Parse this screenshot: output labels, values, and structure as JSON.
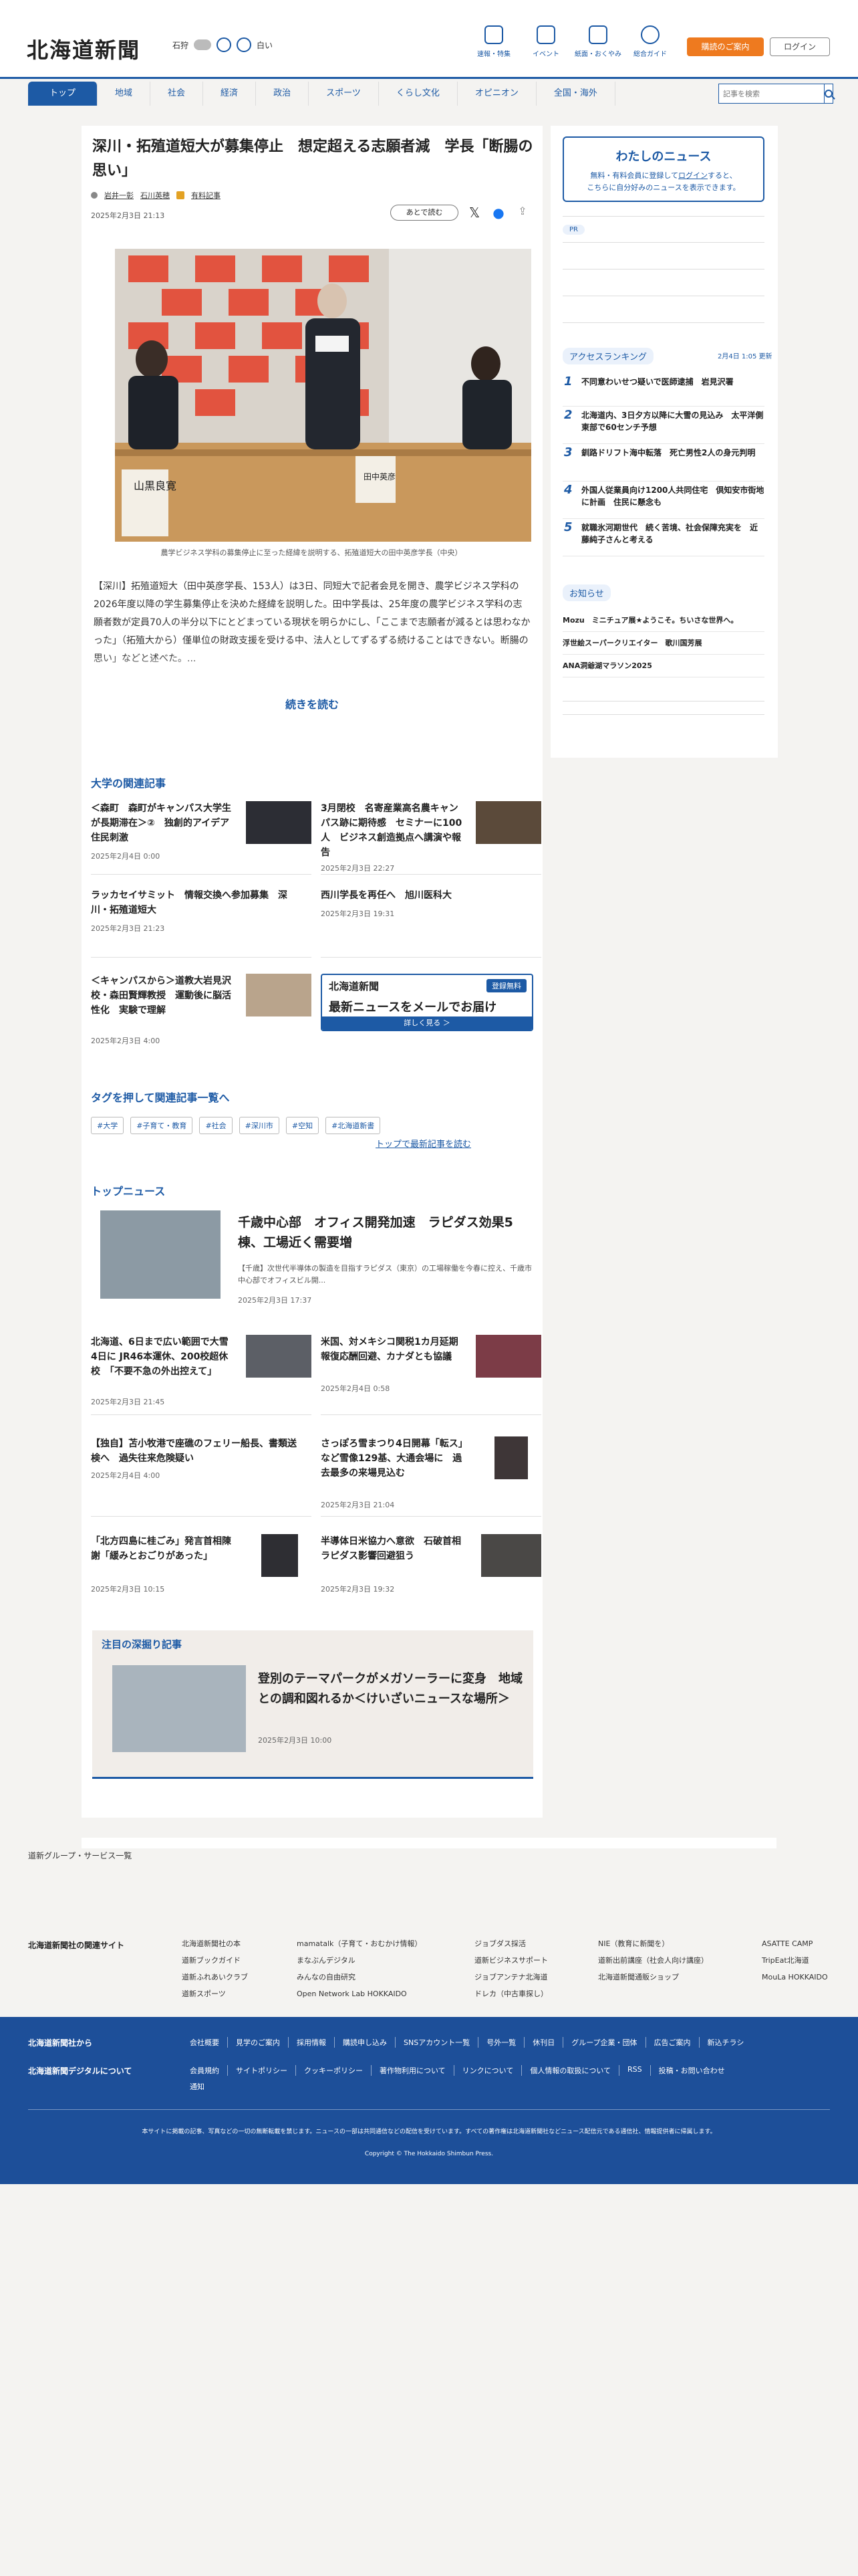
{
  "header": {
    "logo": "北海道新聞",
    "region": "石狩",
    "weather_rain": "白い",
    "icons": [
      {
        "label": "速報・特集",
        "icon": "flag-icon"
      },
      {
        "label": "イベント",
        "icon": "calendar-icon"
      },
      {
        "label": "紙面・おくやみ",
        "icon": "newspaper-icon"
      },
      {
        "label": "総合ガイド",
        "icon": "help-icon"
      }
    ],
    "subscribe_label": "購読のご案内",
    "login_label": "ログイン"
  },
  "nav": {
    "items": [
      "トップ",
      "地域",
      "社会",
      "経済",
      "政治",
      "スポーツ",
      "くらし文化",
      "オピニオン",
      "全国・海外"
    ],
    "search_placeholder": "記事を検索"
  },
  "article": {
    "title": "深川・拓殖道短大が募集停止　想定超える志願者減　学長「断腸の思い」",
    "authors": [
      "岩井一彰",
      "石川英穂"
    ],
    "paid_label": "有料記事",
    "date": "2025年2月3日 21:13",
    "later_label": "あとで読む",
    "caption": "農学ビジネス学科の募集停止に至った経緯を説明する、拓殖道短大の田中英彦学長（中央）",
    "lead": "【深川】拓殖道短大（田中英彦学長、153人）は3日、同短大で記者会見を開き、農学ビジネス学科の2026年度以降の学生募集停止を決めた経緯を説明した。田中学長は、25年度の農学ビジネス学科の志願者数が定員70人の半分以下にとどまっている現状を明らかにし、「ここまで志願者が減るとは思わなかった」（拓殖大から）僅単位の財政支援を受ける中、法人としてずるずる続けることはできない。断腸の思い」などと述べた。...",
    "read_more": "続きを読む",
    "photo_sign": "山黒良寛",
    "photo_sign2": "田中英彦"
  },
  "related": {
    "heading": "大学の関連記事",
    "items": [
      {
        "title": "＜森町　森町がキャンパス大学生が長期滞在＞②　独創的アイデア　住民刺激",
        "date": "2025年2月4日 0:00"
      },
      {
        "title": "3月閉校　名寄産業高名農キャンパス跡に期待感　セミナーに100人　ビジネス創造拠点へ講演や報告",
        "date": "2025年2月3日 22:27"
      },
      {
        "title": "ラッカセイサミット　情報交換へ参加募集　深川・拓殖道短大",
        "date": "2025年2月3日 21:23"
      },
      {
        "title": "西川学長を再任へ　旭川医科大",
        "date": "2025年2月3日 19:31"
      },
      {
        "title": "＜キャンパスから＞道教大岩見沢校・森田賢輝教授　運動後に脳活性化　実験で理解",
        "date": "2025年2月3日 4:00"
      }
    ],
    "banner_logo": "北海道新聞",
    "banner_free": "登録無料",
    "banner_title": "最新ニュースをメールでお届け",
    "banner_more": "詳しく見る ＞"
  },
  "tags": {
    "heading": "タグを押して関連記事一覧へ",
    "items": [
      "#大学",
      "#子育て・教育",
      "#社会",
      "#深川市",
      "#空知",
      "#北海道新書"
    ],
    "top_link": "トップで最新記事を読む"
  },
  "topnews": {
    "heading": "トップニュース",
    "feature": {
      "title": "千歳中心部　オフィス開発加速　ラピダス効果5棟、工場近く需要増",
      "lead": "【千歳】次世代半導体の製造を目指すラピダス（東京）の工場稼働を今春に控え、千歳市中心部でオフィスビル開...",
      "date": "2025年2月3日 17:37"
    },
    "items": [
      {
        "title": "北海道、6日まで広い範囲で大雪　4日に JR46本運休、200校超休校　「不要不急の外出控えて」",
        "date": "2025年2月3日 21:45"
      },
      {
        "title": "米国、対メキシコ関税1カ月延期　報復応酬回避、カナダとも協議",
        "date": "2025年2月4日 0:58"
      },
      {
        "title": "【独自】苫小牧港で座礁のフェリー船長、書類送検へ　過失往来危険疑い",
        "date": "2025年2月4日 4:00"
      },
      {
        "title": "さっぽろ雪まつり4日開幕「転ス」など雪像129基、大通会場に　過去最多の来場見込む",
        "date": "2025年2月3日 21:04"
      },
      {
        "title": "「北方四島に桂ごみ」発言首相陳謝「緩みとおごりがあった」",
        "date": "2025年2月3日 10:15"
      },
      {
        "title": "半導体日米協力へ意欲　石破首相　ラピダス影響回避狙う",
        "date": "2025年2月3日 19:32"
      }
    ]
  },
  "deep": {
    "heading": "注目の深掘り記事",
    "title": "登別のテーマパークがメガソーラーに変身　地域との調和図れるか＜けいざいニュースな場所＞",
    "date": "2025年2月3日 10:00"
  },
  "sidebar": {
    "mynews_title": "わたしのニュース",
    "mynews_text1": "無料・有料会員に登録して",
    "mynews_login": "ログイン",
    "mynews_text2": "すると、",
    "mynews_text3": "こちらに自分好みのニュースを表示できます。",
    "pr": "PR",
    "ranking_title": "アクセスランキング",
    "ranking_date": "2月4日 1:05 更新",
    "ranking": [
      {
        "n": "1",
        "title": "不同意わいせつ疑いで医師逮捕　岩見沢署"
      },
      {
        "n": "2",
        "title": "北海道内、3日夕方以降に大雪の見込み　太平洋側東部で60センチ予想"
      },
      {
        "n": "3",
        "title": "釧路ドリフト海中転落　死亡男性2人の身元判明"
      },
      {
        "n": "4",
        "title": "外国人従業員向け1200人共同住宅　倶知安市街地に計画　住民に懸念も"
      },
      {
        "n": "5",
        "title": "就職氷河期世代　続く苦境、社会保障充実を　近藤純子さんと考える"
      }
    ],
    "notice_title": "お知らせ",
    "notices": [
      "Mozu　ミニチュア展★ようこそ。ちいさな世界へ。",
      "浮世絵スーパークリエイター　歌川国芳展",
      "ANA洞爺湖マラソン2025"
    ]
  },
  "footer": {
    "group_label": "道新グループ・サービス一覧",
    "sites_label": "北海道新聞社の関連サイト",
    "sites": [
      [
        "北海道新聞社の本",
        "道新ブックガイド",
        "道新ふれあいクラブ",
        "道新スポーツ"
      ],
      [
        "mamatalk（子育て・おむかけ情報）",
        "まなぶんデジタル",
        "みんなの自由研究",
        "Open Network Lab HOKKAIDO"
      ],
      [
        "ジョブダス採活",
        "道新ビジネスサポート",
        "ジョブアンテナ北海道",
        "ドレカ（中古車探し）"
      ],
      [
        "NIE（教育に新聞を）",
        "道新出前講座（社会人向け講座）",
        "北海道新聞通販ショップ"
      ],
      [
        "ASATTE CAMP",
        "TripEat北海道",
        "MouLa HOKKAIDO"
      ]
    ],
    "blue_title1": "北海道新聞社から",
    "blue_title2": "北海道新聞デジタルについて",
    "links1": [
      "会社概要",
      "見学のご案内",
      "採用情報",
      "購読申し込み",
      "SNSアカウント一覧",
      "号外一覧",
      "休刊日",
      "グループ企業・団体",
      "広告ご案内",
      "新込チラシ"
    ],
    "links2": [
      "会員規約",
      "サイトポリシー",
      "クッキーポリシー",
      "著作物利用について",
      "リンクについて",
      "個人情報の取扱について",
      "RSS",
      "投稿・お問い合わせ",
      "通知"
    ],
    "note": "本サイトに掲載の記事、写真などの一切の無断転載を禁じます。ニュースの一部は共同通信などの配信を受けています。すべての著作権は北海道新聞社などニュース配信元である通信社、情報提供者に帰属します。",
    "copyright": "Copyright © The Hokkaido Shimbun Press."
  },
  "colors": {
    "brand": "#1d5aa5",
    "accent": "#ee7a1f",
    "paid": "#e3a224"
  }
}
